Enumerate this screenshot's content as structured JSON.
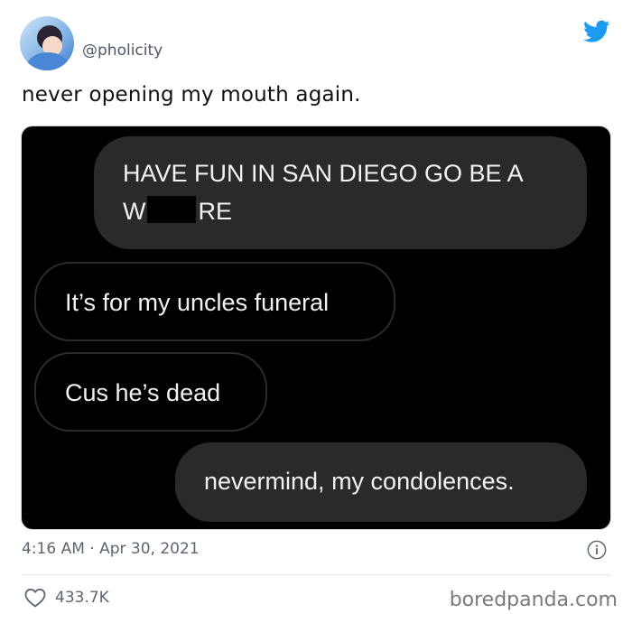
{
  "tweet": {
    "handle": "@pholicity",
    "text": "never opening my mouth again.",
    "timestamp": "4:16 AM · Apr 30, 2021",
    "likes": "433.7K"
  },
  "messages": [
    {
      "side": "sent",
      "line1": "HAVE FUN IN SAN DIEGO GO BE A",
      "line2_start": "W",
      "line2_end": "RE"
    },
    {
      "side": "received",
      "text": "It’s for my uncles funeral"
    },
    {
      "side": "received",
      "text": "Cus he’s dead"
    },
    {
      "side": "sent",
      "text": "nevermind, my condolences."
    }
  ],
  "icons": {
    "twitter": "twitter-bird-icon",
    "info": "info-icon",
    "like": "heart-icon"
  },
  "colors": {
    "twitter_blue": "#1d9bf0",
    "bubble_sent": "#2a2a2c",
    "chat_background": "#000000"
  },
  "watermark": "boredpanda.com"
}
